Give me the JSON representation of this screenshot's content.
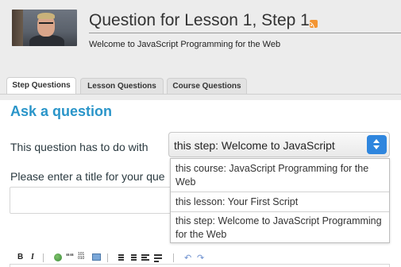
{
  "header": {
    "title": "Question for Lesson 1, Step 1",
    "subtitle": "Welcome to JavaScript Programming for the Web",
    "rss_icon": "rss-icon"
  },
  "tabs": [
    {
      "label": "Step Questions",
      "active": true
    },
    {
      "label": "Lesson Questions",
      "active": false
    },
    {
      "label": "Course Questions",
      "active": false
    }
  ],
  "form": {
    "heading": "Ask a question",
    "topic_label": "This question has to do with",
    "topic_value": "this step: Welcome to JavaScript",
    "title_label": "Please enter a title for your que",
    "title_value": "",
    "topic_options": [
      "this course: JavaScript Programming for the Web",
      "this lesson: Your First Script",
      "this step: Welcome to JavaScript Programming for the Web"
    ]
  },
  "toolbar": {
    "bold": "B",
    "italic": "I",
    "quote": "““",
    "code_top": "101",
    "code_bottom": "010",
    "undo": "↶",
    "redo": "↷"
  },
  "colors": {
    "accent": "#2a95c9",
    "select_arrow": "#2f86de",
    "rss": "#f39533",
    "header_bg": "#ececec"
  }
}
